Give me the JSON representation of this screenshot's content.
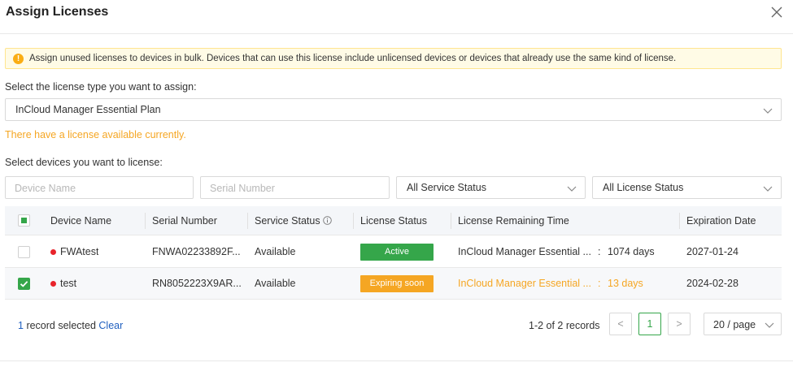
{
  "dialog": {
    "title": "Assign Licenses"
  },
  "alert": {
    "text": "Assign unused licenses to devices in bulk. Devices that can use this license include unlicensed devices or devices that already use the same kind of license."
  },
  "license_type": {
    "label": "Select the license type you want to assign:",
    "selected": "InCloud Manager Essential Plan"
  },
  "availability_text": "There have a license available currently.",
  "devices": {
    "label": "Select devices you want to license:",
    "filters": {
      "device_name_placeholder": "Device Name",
      "serial_number_placeholder": "Serial Number",
      "service_status": "All Service Status",
      "license_status": "All License Status"
    }
  },
  "table": {
    "headers": {
      "device_name": "Device Name",
      "serial_number": "Serial Number",
      "service_status": "Service Status",
      "license_status": "License Status",
      "remaining_time": "License Remaining Time",
      "expiration_date": "Expiration Date"
    },
    "rows": [
      {
        "selected": false,
        "device_name": "FWAtest",
        "serial_number": "FNWA02233892F...",
        "service_status": "Available",
        "license_status": "Active",
        "remaining_plan": "InCloud Manager Essential ...",
        "remaining_sep": ":",
        "remaining_days": "1074 days",
        "expiration_date": "2027-01-24"
      },
      {
        "selected": true,
        "device_name": "test",
        "serial_number": "RN8052223X9AR...",
        "service_status": "Available",
        "license_status": "Expiring soon",
        "remaining_plan": "InCloud Manager Essential ...",
        "remaining_sep": ":",
        "remaining_days": "13 days",
        "expiration_date": "2024-02-28"
      }
    ]
  },
  "footer": {
    "selected_count": "1",
    "selected_text": "record selected",
    "clear_label": "Clear",
    "total_text": "1-2 of 2 records",
    "prev_label": "<",
    "current_page": "1",
    "next_label": ">",
    "page_size": "20 / page"
  },
  "colors": {
    "accent": "#35a64a",
    "warning": "#f5a623",
    "link": "#1f5fbf",
    "online_dot": "#e8242b"
  }
}
